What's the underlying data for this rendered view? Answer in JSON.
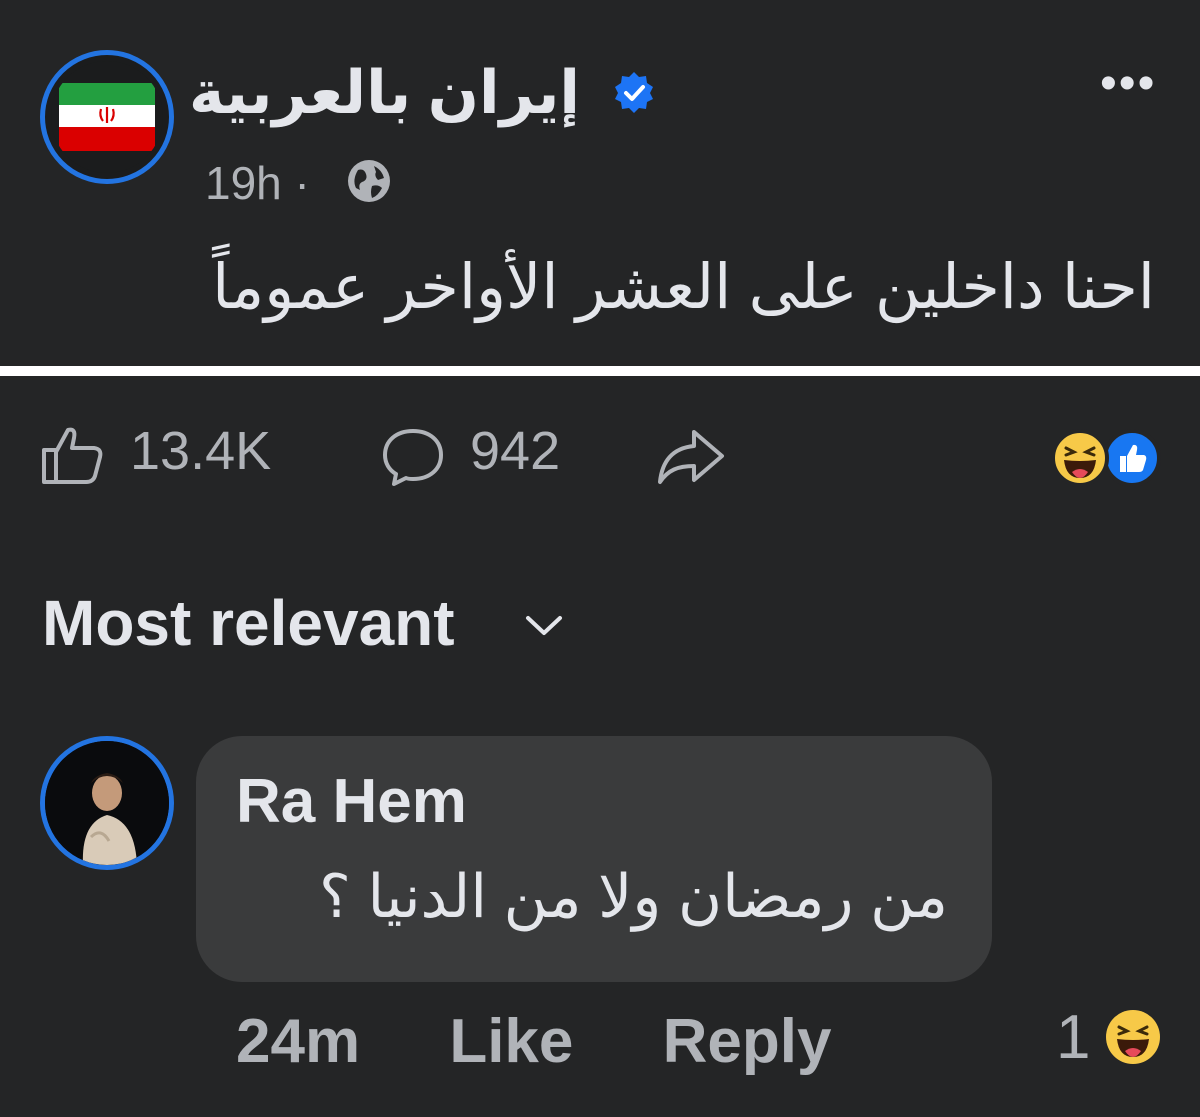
{
  "post": {
    "page_name": "إيران بالعربية",
    "time": "19h",
    "separator": "·",
    "more_label": "•••",
    "text": "احنا داخلين على العشر الأواخر عموماً",
    "icons": [
      "iran-flag-icon",
      "verified-badge-icon",
      "globe-icon",
      "more-icon"
    ]
  },
  "stats": {
    "likes": "13.4K",
    "comments": "942",
    "icons": [
      "like-icon",
      "comment-icon",
      "share-icon",
      "haha-reaction-icon",
      "like-reaction-icon"
    ]
  },
  "sort": {
    "label": "Most relevant"
  },
  "comment": {
    "author": "Ra Hem",
    "text": "من رمضان ولا من الدنيا ؟",
    "time": "24m",
    "like_label": "Like",
    "reply_label": "Reply",
    "reaction_count": "1"
  },
  "colors": {
    "background": "#242526",
    "bubble": "#3a3b3c",
    "accent": "#2374e1",
    "text_primary": "#e4e6eb",
    "text_secondary": "#b0b3b8"
  }
}
